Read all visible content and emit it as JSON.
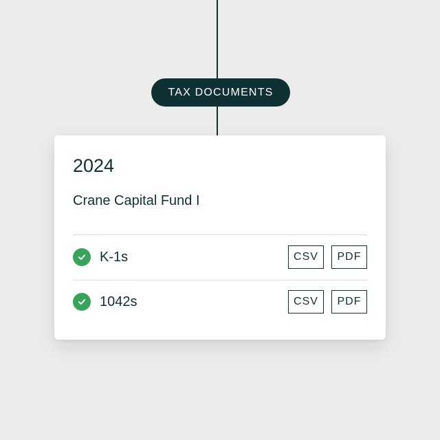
{
  "timeline": {
    "tag_label": "TAX DOCUMENTS"
  },
  "card": {
    "year": "2024",
    "fund_name": "Crane Capital Fund I",
    "documents": [
      {
        "label": "K-1s",
        "status_icon": "check-circle-icon",
        "formats": [
          "CSV",
          "PDF"
        ]
      },
      {
        "label": "1042s",
        "status_icon": "check-circle-icon",
        "formats": [
          "CSV",
          "PDF"
        ]
      }
    ]
  },
  "colors": {
    "background": "#ececec",
    "primary_dark": "#0f3133",
    "success_green": "#3aa35a",
    "card": "#ffffff"
  }
}
